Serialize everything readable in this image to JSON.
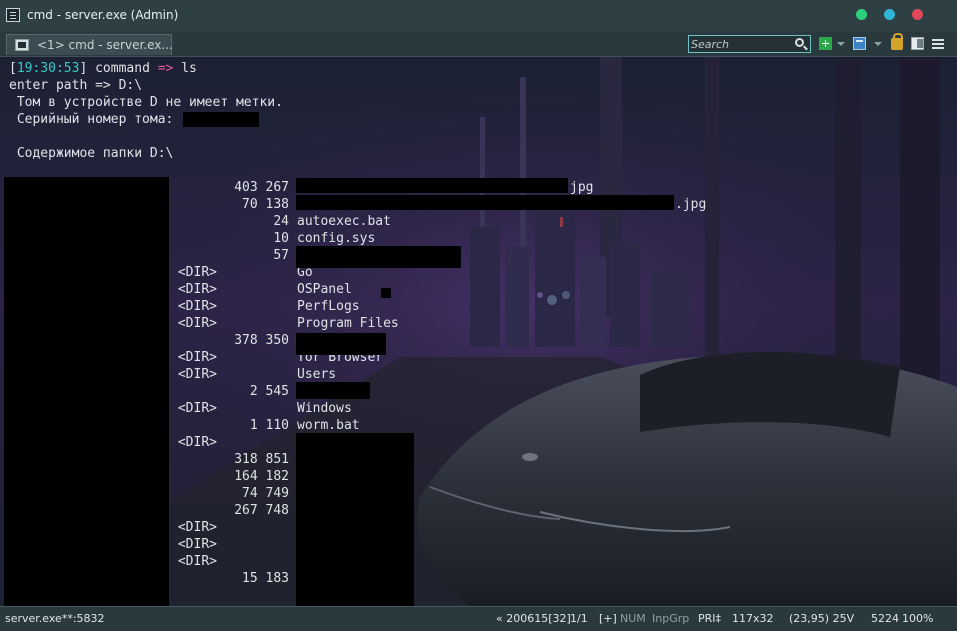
{
  "window": {
    "title": "cmd - server.exe (Admin)"
  },
  "tabs": [
    {
      "label": "<1> cmd - server.ex..."
    }
  ],
  "toolbar": {
    "search_placeholder": "Search"
  },
  "console": {
    "prompt_time": "19:30:53",
    "prompt_cmd": "command",
    "prompt_arrow": "=>",
    "prompt_input": "ls",
    "lines": [
      "enter path => D:\\",
      " Том в устройстве D не имеет метки.",
      " Серийный номер тома:",
      "",
      " Содержимое папки D:\\"
    ],
    "entries": [
      {
        "dir": "",
        "size": "403 267",
        "name": "jpg"
      },
      {
        "dir": "",
        "size": "70 138",
        "name": ".jpg"
      },
      {
        "dir": "",
        "size": "24",
        "name": "autoexec.bat"
      },
      {
        "dir": "",
        "size": "10",
        "name": "config.sys"
      },
      {
        "dir": "",
        "size": "57",
        "name": ""
      },
      {
        "dir": "<DIR>",
        "size": "",
        "name": "Go"
      },
      {
        "dir": "<DIR>",
        "size": "",
        "name": "OSPanel"
      },
      {
        "dir": "<DIR>",
        "size": "",
        "name": "PerfLogs"
      },
      {
        "dir": "<DIR>",
        "size": "",
        "name": "Program Files"
      },
      {
        "dir": "",
        "size": "378 350",
        "name": ""
      },
      {
        "dir": "<DIR>",
        "size": "",
        "name": "Tor Browser"
      },
      {
        "dir": "<DIR>",
        "size": "",
        "name": "Users"
      },
      {
        "dir": "",
        "size": "2 545",
        "name": ""
      },
      {
        "dir": "<DIR>",
        "size": "",
        "name": "Windows"
      },
      {
        "dir": "",
        "size": "1 110",
        "name": "worm.bat"
      },
      {
        "dir": "<DIR>",
        "size": "",
        "name": ""
      },
      {
        "dir": "",
        "size": "318 851",
        "name": ""
      },
      {
        "dir": "",
        "size": "164 182",
        "name": ""
      },
      {
        "dir": "",
        "size": "74 749",
        "name": ""
      },
      {
        "dir": "",
        "size": "267 748",
        "name": ""
      },
      {
        "dir": "<DIR>",
        "size": "",
        "name": ""
      },
      {
        "dir": "<DIR>",
        "size": "",
        "name": ""
      },
      {
        "dir": "<DIR>",
        "size": "",
        "name": ""
      },
      {
        "dir": "",
        "size": "15 183",
        "name": ""
      }
    ]
  },
  "statusbar": {
    "process": "server.exe**:5832",
    "pos": "« 200615[32]",
    "page": "1/1",
    "plus": "[+]",
    "num": "NUM",
    "inpgrp": "InpGrp",
    "pri": "PRI‡",
    "size": "117x32",
    "coords": "(23,95) 25V",
    "pid": "5224",
    "zoom": "100%"
  }
}
